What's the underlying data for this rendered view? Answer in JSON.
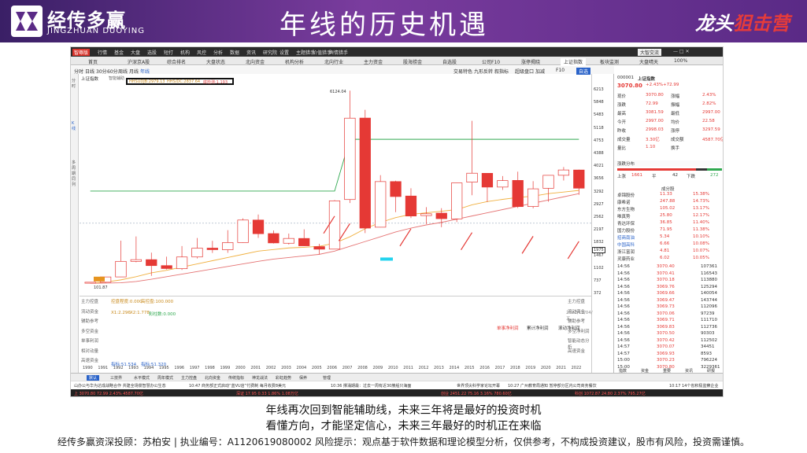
{
  "brand": {
    "name": "经传多赢",
    "name_en": "JINGZHUAN DUOYING",
    "page_title": "年线的历史机遇",
    "campaign_a": "龙头",
    "campaign_b": "狙击营"
  },
  "toolbar_top": [
    "行情",
    "基金",
    "大盘",
    "选股",
    "短打",
    "机构",
    "风控",
    "分析",
    "数据",
    "资讯",
    "研究院",
    "设置",
    "主题猎手",
    "价值猎手",
    "舆情猎手"
  ],
  "app_badge": "智尊版",
  "version": "大智交流",
  "zoom_label": "100%",
  "tabs": [
    "首页",
    "沪深京A股",
    "综合排名",
    "大盘状态",
    "北向资金",
    "机构分析",
    "北向行业",
    "主力资金",
    "股海捞金",
    "自选股",
    "公司F10",
    "涨停揭晓",
    "上证指数",
    "板块监测",
    "大盘晴天"
  ],
  "periods": [
    "分时",
    "日线",
    "30分",
    "60分",
    "周线",
    "月线",
    "年线"
  ],
  "controls": [
    "交易特色",
    "九形反转",
    "叙指标",
    "超级盘口",
    "加减",
    "F10",
    "自选"
  ],
  "left_side": [
    "分时",
    "K线",
    "多周期同列"
  ],
  "chart_label": "上证指数",
  "chart_sub": "智能辅助",
  "indicator_line": {
    "a": "HHSUDJB:2979.13",
    "b": "HHS/DC:2837.64",
    "c": "底检测:1.193"
  },
  "yaxis": [
    "6213",
    "5848",
    "5483",
    "5118",
    "4753",
    "4388",
    "4021",
    "3656",
    "3292",
    "2927",
    "2562",
    "2197",
    "1832",
    "1467",
    "1102",
    "737",
    "372"
  ],
  "peak_label": "6124.04",
  "low_label": "101.87",
  "cur_tag": "1975",
  "chart_data": {
    "type": "candlestick",
    "x": [
      "1990",
      "1991",
      "1992",
      "1993",
      "1994",
      "1995",
      "1996",
      "1997",
      "1998",
      "1999",
      "2000",
      "2001",
      "2002",
      "2003",
      "2004",
      "2005",
      "2006",
      "2007",
      "2008",
      "2009",
      "2010",
      "2011",
      "2012",
      "2013",
      "2014",
      "2015",
      "2016",
      "2017",
      "2018",
      "2019",
      "2020",
      "2021",
      "2022"
    ],
    "open": [
      96,
      127,
      293,
      780,
      833,
      647,
      550,
      917,
      1194,
      1144,
      1368,
      2073,
      1649,
      1347,
      1497,
      1242,
      1163,
      2715,
      5265,
      1849,
      3277,
      2825,
      2212,
      2289,
      2109,
      3258,
      3536,
      3105,
      3314,
      2497,
      3067,
      3474,
      3639
    ],
    "close": [
      127,
      292,
      780,
      833,
      647,
      555,
      917,
      1194,
      1146,
      1367,
      2073,
      1645,
      1357,
      1497,
      1266,
      1161,
      2675,
      5262,
      1821,
      3277,
      2808,
      2199,
      2269,
      2116,
      3235,
      3539,
      3104,
      3307,
      2494,
      3050,
      3473,
      3640,
      3070
    ],
    "high": [
      127,
      293,
      1429,
      1559,
      1053,
      927,
      1259,
      1510,
      1422,
      1756,
      2125,
      2245,
      1748,
      1649,
      1783,
      1328,
      2698,
      6124,
      5522,
      3478,
      3306,
      3067,
      2478,
      2444,
      3239,
      5178,
      3539,
      3450,
      3587,
      3288,
      3474,
      3731,
      3651
    ],
    "low": [
      95,
      105,
      293,
      750,
      325,
      525,
      512,
      870,
      1043,
      1047,
      1361,
      1514,
      1339,
      1307,
      1259,
      998,
      1161,
      2605,
      1664,
      1844,
      2319,
      2134,
      1949,
      1849,
      2010,
      2850,
      2638,
      3016,
      2449,
      2440,
      2646,
      3312,
      2863
    ],
    "lines": [
      {
        "color": "#2fa84f",
        "values": [
          2979,
          2979,
          2979,
          2979,
          2979,
          2979,
          2979,
          2979,
          2979,
          2979,
          2979,
          2979,
          2979,
          2979,
          2979,
          2979,
          2979,
          4600,
          4600,
          4600,
          4600,
          4600,
          4600,
          4600,
          4600,
          4600,
          4600,
          4600,
          4600,
          4600,
          4600,
          4600,
          4600
        ]
      },
      {
        "color": "#e57373",
        "values": [
          95,
          100,
          110,
          150,
          220,
          300,
          380,
          460,
          540,
          620,
          700,
          780,
          850,
          900,
          950,
          1000,
          1100,
          1250,
          1400,
          1550,
          1700,
          1820,
          1920,
          2000,
          2100,
          2200,
          2300,
          2400,
          2500,
          2600,
          2700,
          2800,
          2900
        ]
      },
      {
        "color": "#f0b040",
        "values": [
          100,
          130,
          200,
          300,
          420,
          500,
          600,
          700,
          800,
          900,
          1000,
          1100,
          1150,
          1200,
          1220,
          1250,
          1350,
          1550,
          1800,
          2000,
          2150,
          2250,
          2300,
          2350,
          2400,
          2550,
          2650,
          2720,
          2780,
          2820,
          2900,
          2950,
          3000
        ]
      }
    ],
    "ylim": [
      0,
      6400
    ]
  },
  "quote": {
    "code": "000001",
    "name": "上证指数",
    "price": "3070.80",
    "chg": "+2.43%",
    "chg_pts": "+72.99",
    "rows": [
      [
        "现价",
        "3070.80",
        "涨幅",
        "2.43%"
      ],
      [
        "涨跌",
        "72.99",
        "振幅",
        "2.82%"
      ],
      [
        "最高",
        "3081.59",
        "最低",
        "2997.00"
      ],
      [
        "今开",
        "2997.00",
        "均价",
        "22.58"
      ],
      [
        "昨收",
        "2998.03",
        "涨停",
        "3297.59"
      ],
      [
        "成交量",
        "3.30亿",
        "成交额",
        "4587.70亿"
      ],
      [
        "量比",
        "1.10",
        "换手",
        ""
      ]
    ],
    "dist_label": "涨跌分布",
    "up": "上涨",
    "up_n": "1661",
    "flat": "平",
    "flat_n": "42",
    "down": "下跌",
    "down_n": "272",
    "comp_label": "成分股",
    "comps": [
      [
        "卓锦股份",
        "11.33",
        "15.38%"
      ],
      [
        "康希诺",
        "247.88",
        "14.73%"
      ],
      [
        "东方生物",
        "105.02",
        "13.17%"
      ],
      [
        "唯真势",
        "25.80",
        "12.17%"
      ],
      [
        "青达环保",
        "36.85",
        "11.40%"
      ],
      [
        "国力股份",
        "71.95",
        "11.38%"
      ],
      [
        "招商南油",
        "5.34",
        "10.10%"
      ],
      [
        "中国高科",
        "6.66",
        "10.08%"
      ],
      [
        "浙江富润",
        "4.81",
        "10.07%"
      ],
      [
        "灵康药业",
        "6.02",
        "10.05%"
      ]
    ],
    "ticks": [
      [
        "14:56",
        "3070.40",
        "107361"
      ],
      [
        "14:56",
        "3070.41",
        "116543"
      ],
      [
        "14:56",
        "3070.18",
        "113880"
      ],
      [
        "14:56",
        "3069.76",
        "125294"
      ],
      [
        "14:56",
        "3069.66",
        "140054"
      ],
      [
        "14:56",
        "3069.47",
        "143744"
      ],
      [
        "14:56",
        "3069.73",
        "112096"
      ],
      [
        "14:56",
        "3070.06",
        "97239"
      ],
      [
        "14:56",
        "3069.71",
        "111710"
      ],
      [
        "14:56",
        "3069.83",
        "112736"
      ],
      [
        "14:56",
        "3070.50",
        "90303"
      ],
      [
        "14:56",
        "3070.42",
        "112502"
      ],
      [
        "14:57",
        "3070.07",
        "34451"
      ],
      [
        "14:57",
        "3069.93",
        "8593"
      ],
      [
        "15:00",
        "3070.23",
        "796224"
      ],
      [
        "15:00",
        "3070.80",
        "3229361"
      ]
    ],
    "rtabs": [
      "指数",
      "资金",
      "重要",
      "资讯",
      "研报"
    ]
  },
  "ind_labels": [
    "主力控盘",
    "流动资金",
    "辅助参考",
    "多空资金",
    "单事利润",
    "相对动量",
    "高速资金"
  ],
  "ind_values": {
    "a": "控盘程度:0.000",
    "b": "高控盘:100.000",
    "c": "X1:2.296",
    "d": "X2:1.778",
    "e": "彩柱数:0.000",
    "f": "指标:51.534",
    "g": "指标:51.320"
  },
  "ind_right": [
    "单事净利润",
    "累计净利润",
    "滚动净利润"
  ],
  "ind_right2": [
    "主力控盘",
    "流动资金",
    "辅助参考",
    "多空净利润",
    "智能动态分析",
    "高速资金"
  ],
  "date_label": "2022/11/04/五",
  "btabs": [
    "默认",
    "三技界",
    "水平模式",
    "周年模式",
    "主力控盘",
    "北向资金",
    "传统指标",
    "神龙战法",
    "彩虹趋势",
    "保养",
    "管理"
  ],
  "news": [
    "山办公与华为达成战略合作 共建全场景智慧办公生态",
    "10:47 商务部正式启动“蓝VU店”付费制 每月收费8美元",
    "10:36 撑涌期最：过去一周有近30艘船只海面",
    "世界顶尖科学家论坛开幕",
    "10:27 广州教育局通知 暂停部分区内公司商务餐饮",
    "10:17 14个省积极监察企业"
  ],
  "status": {
    "sh": "上 3070.80 72.99 2.43% 4587.70亿",
    "sz": "深证 17.95 0.33 1.86% 1.08万亿",
    "cy": "创业 2451.22 75.16 3.16% 780.60亿",
    "kc": "科创 1072.87 24.80 2.37% 795.27亿"
  },
  "caption1": "年线再次回到智能辅助线，未来三年将是最好的投资时机",
  "caption2": "看懂方向，才能坚定信心，未来三年最好的时机正在来临",
  "footer": "经传多赢资深投顾：苏柏安 | 执业编号：A1120619080002  风险提示：观点基于软件数据和理论模型分析，仅供参考，不构成投资建议，股市有风险，投资需谨慎。"
}
